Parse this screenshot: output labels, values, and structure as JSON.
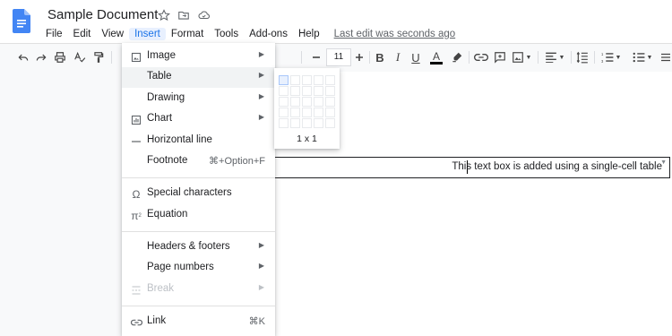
{
  "title": "Sample Document",
  "menubar": {
    "items": [
      "File",
      "Edit",
      "View",
      "Insert",
      "Format",
      "Tools",
      "Add-ons",
      "Help"
    ],
    "last_edit": "Last edit was seconds ago"
  },
  "toolbar": {
    "font_size": "11"
  },
  "insert_menu": {
    "items": [
      {
        "icon": "image-icon",
        "label": "Image",
        "submenu": true
      },
      {
        "icon": "",
        "label": "Table",
        "submenu": true,
        "highlighted": true
      },
      {
        "icon": "",
        "label": "Drawing",
        "submenu": true
      },
      {
        "icon": "chart-icon",
        "label": "Chart",
        "submenu": true
      },
      {
        "icon": "horizontal-line-icon",
        "label": "Horizontal line"
      },
      {
        "icon": "",
        "label": "Footnote",
        "shortcut": "⌘+Option+F"
      },
      {
        "icon": "omega-icon",
        "label": "Special characters"
      },
      {
        "icon": "pi-icon",
        "label": "Equation"
      },
      {
        "icon": "",
        "label": "Headers & footers",
        "submenu": true
      },
      {
        "icon": "",
        "label": "Page numbers",
        "submenu": true
      },
      {
        "icon": "break-icon",
        "label": "Break",
        "submenu": true,
        "disabled": true
      },
      {
        "icon": "link-icon",
        "label": "Link",
        "shortcut": "⌘K"
      }
    ]
  },
  "table_grid": {
    "dimension_label": "1 x 1"
  },
  "document": {
    "textbox_text": "This text box is added using a single-cell table"
  },
  "colors": {
    "accent": "#1a73e8",
    "docs_blue": "#4285f4",
    "menu_highlight": "#f1f3f4"
  }
}
